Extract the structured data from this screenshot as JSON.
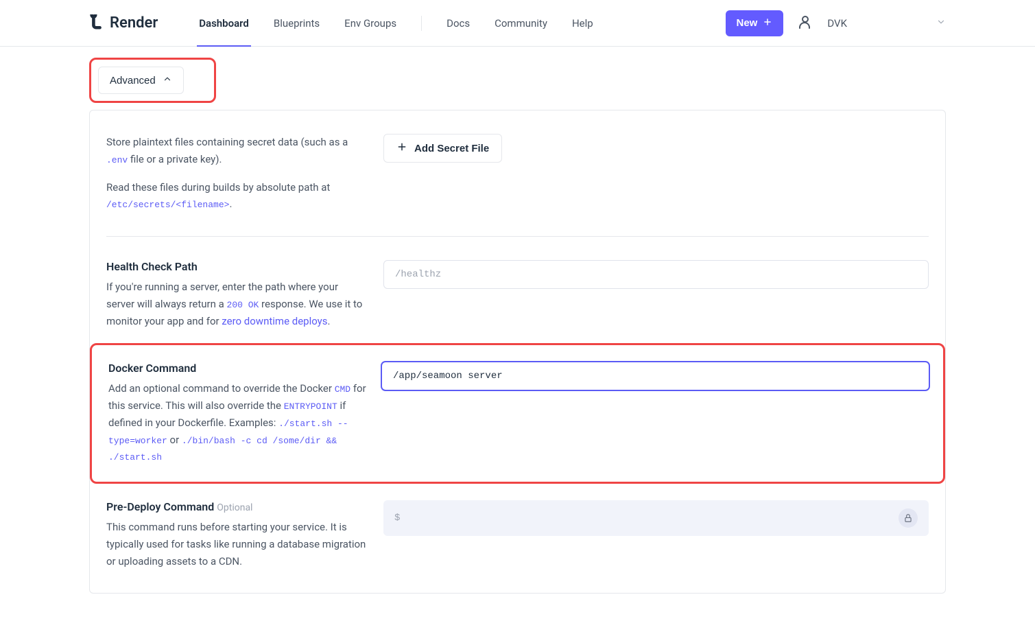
{
  "brand": "Render",
  "nav": {
    "dashboard": "Dashboard",
    "blueprints": "Blueprints",
    "envgroups": "Env Groups",
    "docs": "Docs",
    "community": "Community",
    "help": "Help"
  },
  "new_button": "New",
  "user_name": "DVK",
  "advanced_label": "Advanced",
  "secret_files": {
    "desc_1": "Store plaintext files containing secret data (such as a ",
    "code_1": ".env",
    "desc_2": " file or a private key).",
    "desc_3": "Read these files during builds by absolute path at ",
    "code_2": "/etc/secrets/<filename>",
    "period": ".",
    "button": "Add Secret File"
  },
  "health_check": {
    "title": "Health Check Path",
    "desc_1": "If you're running a server, enter the path where your server will always return a ",
    "code_1": "200 OK",
    "desc_2": " response. We use it to monitor your app and for ",
    "link": "zero downtime deploys",
    "period": ".",
    "placeholder": "/healthz"
  },
  "docker": {
    "title": "Docker Command",
    "desc_1": "Add an optional command to override the Docker ",
    "code_cmd": "CMD",
    "desc_2": " for this service. This will also override the ",
    "code_entry": "ENTRYPOINT",
    "desc_3": " if defined in your Dockerfile. Examples: ",
    "ex1": "./start.sh --type=worker",
    "or": " or ",
    "ex2": "./bin/bash -c cd /some/dir && ./start.sh",
    "value": "/app/seamoon server"
  },
  "predeploy": {
    "title": "Pre-Deploy Command",
    "optional": "Optional",
    "desc": "This command runs before starting your service. It is typically used for tasks like running a database migration or uploading assets to a CDN.",
    "placeholder": "$"
  }
}
